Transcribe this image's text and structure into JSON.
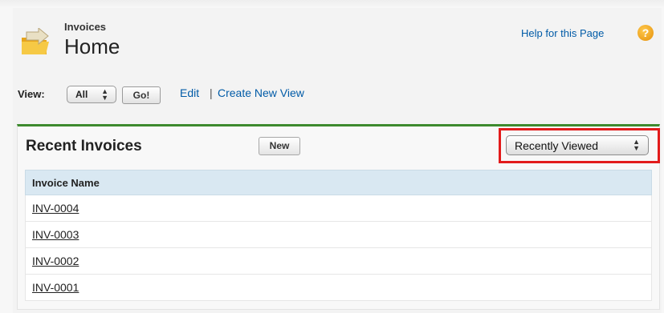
{
  "header": {
    "object_label": "Invoices",
    "title": "Home",
    "icon": "folder-arrow-icon",
    "help_link": "Help for this Page",
    "help_icon": "question-icon"
  },
  "view_bar": {
    "label": "View:",
    "selected": "All",
    "go_label": "Go!",
    "edit_link": "Edit",
    "separator": "|",
    "create_link": "Create New View"
  },
  "recent": {
    "title": "Recent Invoices",
    "new_label": "New",
    "filter_selected": "Recently Viewed",
    "highlight_color": "#e21b1b",
    "accent_color": "#3d8a2e",
    "columns": [
      "Invoice Name"
    ],
    "rows": [
      "INV-0004",
      "INV-0003",
      "INV-0002",
      "INV-0001"
    ]
  }
}
